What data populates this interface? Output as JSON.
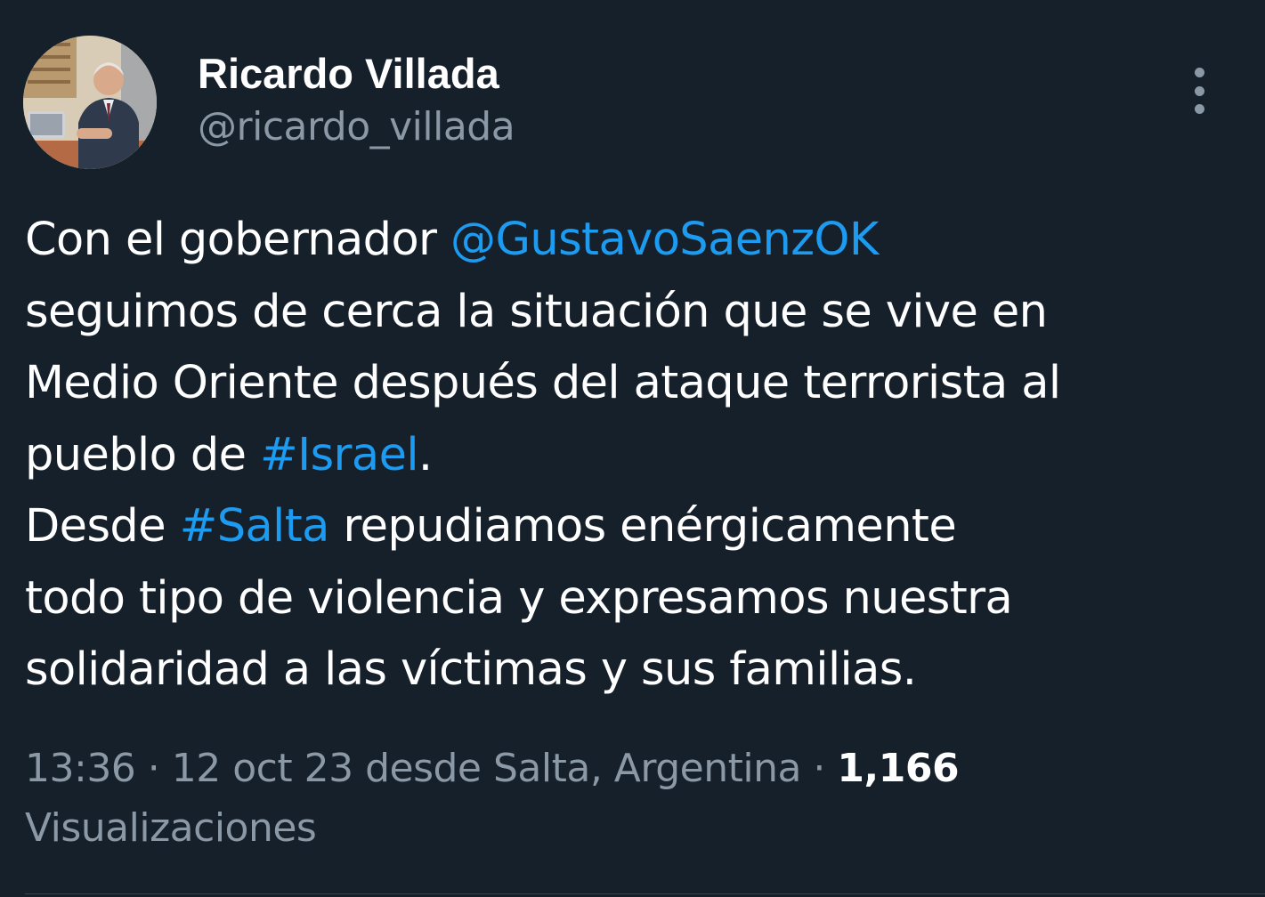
{
  "author": {
    "name": "Ricardo Villada",
    "handle": "@ricardo_villada",
    "avatar_icon": "profile-photo"
  },
  "more_icon": "more-vertical-icon",
  "tweet": {
    "line1_text": "Con el gobernador ",
    "line1_mention": "@GustavoSaenzOK",
    "line2": "seguimos de cerca la situación que se vive en",
    "line3": "Medio Oriente después del ataque terrorista al",
    "line4_text": "pueblo de ",
    "line4_hashtag": "#Israel",
    "line4_end": ".",
    "line5_text": "Desde ",
    "line5_hashtag": "#Salta",
    "line5_end": " repudiamos enérgicamente",
    "line6": "todo tipo de violencia y expresamos nuestra",
    "line7": "solidaridad a las víctimas y sus familias."
  },
  "meta": {
    "time": "13:36",
    "separator": " · ",
    "date": "12 oct 23",
    "source": " desde Salta, Argentina",
    "views_count": "1,166",
    "views_label": "Visualizaciones"
  },
  "colors": {
    "background": "#15202b",
    "text": "#ffffff",
    "secondary": "#8b98a5",
    "link": "#1d9bf0"
  }
}
